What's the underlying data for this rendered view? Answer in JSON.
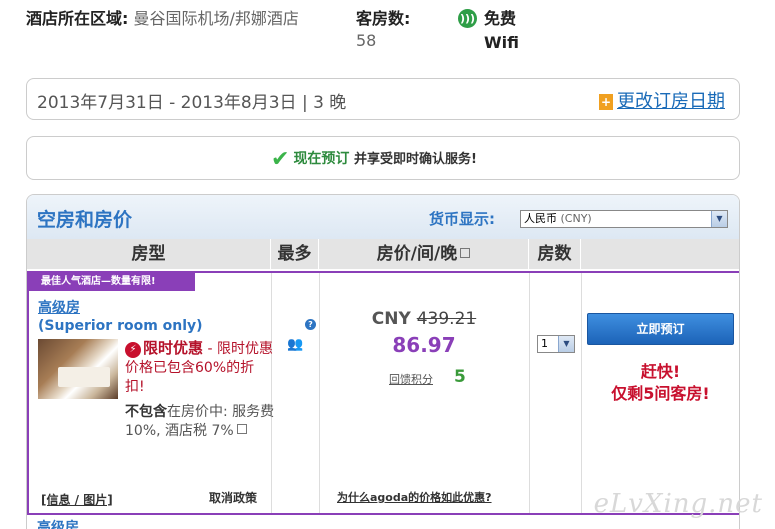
{
  "hotel_info": {
    "area_label": "酒店所在区域:",
    "area_value": "曼谷国际机场/邦娜酒店",
    "rooms_label": "客房数:",
    "rooms_value": "58",
    "wifi_line1": "免费",
    "wifi_line2": "Wifi"
  },
  "stay": {
    "date_range": "2013年7月31日 - 2013年8月3日 | 3 晚",
    "change_date_label": "更改订房日期"
  },
  "confirm": {
    "now_book": "现在预订",
    "message": "并享受即时确认服务!"
  },
  "availability": {
    "title": "空房和房价",
    "currency_label": "货币显示:",
    "currency_value": "人民币",
    "currency_code": "(CNY)"
  },
  "columns": {
    "room_type": "房型",
    "max": "最多",
    "price": "房价/间/晚",
    "rooms": "房数"
  },
  "room": {
    "badge": "最佳人气酒店—数量有限!",
    "name": "高级房",
    "name_en": "(Superior room only)",
    "promo_title": "限时优惠",
    "promo_text": "- 限时优惠 价格已包含60%的折扣!",
    "excl_label": "不包含",
    "excl_text": "在房价中: 服务费 10%, 酒店税 7%",
    "info_link": "[信息 / 图片]",
    "cancel_link": "取消政策",
    "currency": "CNY",
    "original_price": "439.21",
    "price": "86.97",
    "points_label": "回馈积分",
    "points_value": "5",
    "why_link": "为什么agoda的价格如此优惠?",
    "qty_value": "1",
    "book_button": "立即预订",
    "hurry_line1": "赶快!",
    "hurry_line2": "仅剩5间客房!"
  },
  "next_room": {
    "name": "高级房"
  },
  "watermark": "eLvXing.net"
}
